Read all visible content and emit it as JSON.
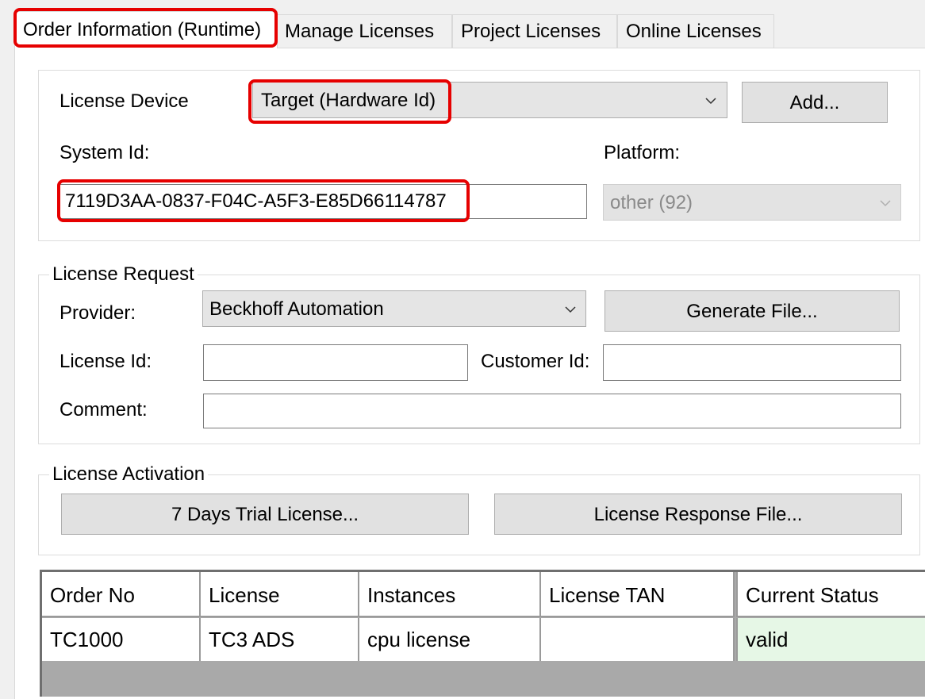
{
  "tabs": [
    {
      "label": "Order Information (Runtime)",
      "active": true
    },
    {
      "label": "Manage Licenses",
      "active": false
    },
    {
      "label": "Project Licenses",
      "active": false
    },
    {
      "label": "Online Licenses",
      "active": false
    }
  ],
  "device": {
    "license_device_label": "License Device",
    "license_device_value": "Target (Hardware Id)",
    "add_button": "Add...",
    "system_id_label": "System Id:",
    "system_id_value": "7119D3AA-0837-F04C-A5F3-E85D66114787",
    "platform_label": "Platform:",
    "platform_value": "other (92)"
  },
  "request": {
    "legend": "License Request",
    "provider_label": "Provider:",
    "provider_value": "Beckhoff Automation",
    "generate_button": "Generate File...",
    "license_id_label": "License Id:",
    "license_id_value": "",
    "customer_id_label": "Customer Id:",
    "customer_id_value": "",
    "comment_label": "Comment:",
    "comment_value": ""
  },
  "activation": {
    "legend": "License Activation",
    "trial_button": "7 Days Trial License...",
    "response_button": "License Response File..."
  },
  "table": {
    "columns": [
      "Order No",
      "License",
      "Instances",
      "License TAN",
      "Current Status"
    ],
    "rows": [
      [
        "TC1000",
        "TC3 ADS",
        "cpu license",
        "",
        "valid"
      ]
    ]
  },
  "colors": {
    "highlight": "#e60000",
    "valid_status_bg": "#e6f7e6"
  },
  "icons": {
    "dropdown": "chevron-down-icon"
  }
}
